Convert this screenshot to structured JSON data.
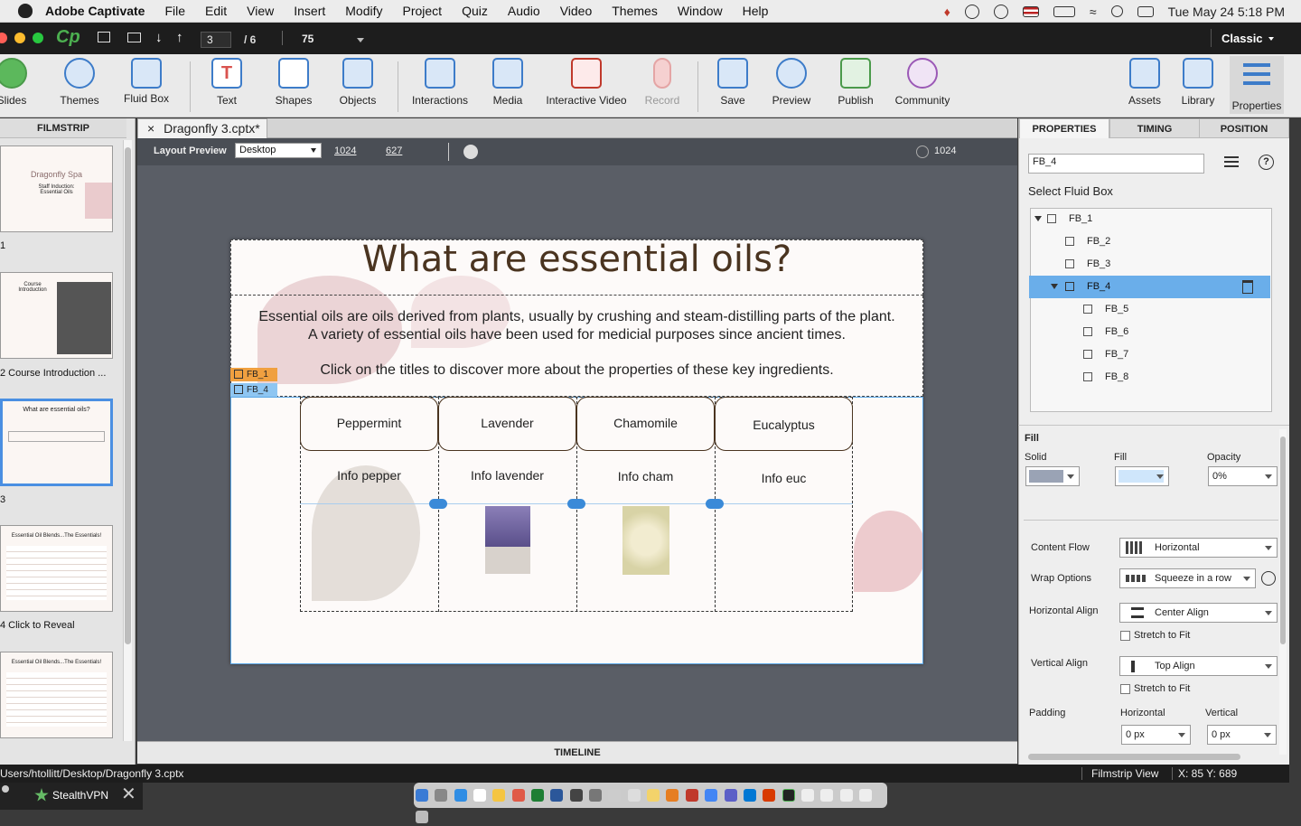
{
  "menubar": {
    "app_name": "Adobe Captivate",
    "items": [
      "File",
      "Edit",
      "View",
      "Insert",
      "Modify",
      "Project",
      "Quiz",
      "Audio",
      "Video",
      "Themes",
      "Window",
      "Help"
    ],
    "datetime": "Tue May 24  5:18 PM"
  },
  "topbar": {
    "slide_current": "3",
    "slide_total": "/ 6",
    "zoom": "75",
    "workspace": "Classic"
  },
  "toolbar": {
    "slides": "Slides",
    "themes": "Themes",
    "fluid_box": "Fluid Box",
    "text": "Text",
    "shapes": "Shapes",
    "objects": "Objects",
    "interactions": "Interactions",
    "media": "Media",
    "interactive_video": "Interactive Video",
    "record": "Record",
    "save": "Save",
    "preview": "Preview",
    "publish": "Publish",
    "community": "Community",
    "assets": "Assets",
    "library": "Library",
    "properties": "Properties"
  },
  "filmstrip": {
    "header": "FILMSTRIP",
    "slides": [
      {
        "label": "1",
        "title": "Dragonfly Spa",
        "subtitle": "Staff Induction:",
        "subtitle2": "Essential Oils"
      },
      {
        "label": "2 Course Introduction ...",
        "title": "Course Introduction"
      },
      {
        "label": "3",
        "title": "What are essential oils?"
      },
      {
        "label": "4 Click to Reveal",
        "title": "Essential Oil Blends...The Essentials!"
      },
      {
        "label": "",
        "title": "Essential Oil Blends...The Essentials!"
      }
    ]
  },
  "document": {
    "tab_title": "Dragonfly 3.cptx*",
    "close": "×"
  },
  "stagebar": {
    "layout_label": "Layout Preview",
    "device": "Desktop",
    "width": "1024",
    "height": "627",
    "ruler_value": "1024"
  },
  "slide": {
    "title": "What are essential oils?",
    "body_line1": "Essential oils are oils derived from plants, usually by crushing and steam-distilling parts of the plant.",
    "body_line2": "A variety of essential oils have been used for medicial purposes since ancient times.",
    "instruction": "Click on the titles to discover more about the properties of these key ingredients.",
    "tag_fb1": "FB_1",
    "tag_fb4": "FB_4",
    "columns": [
      {
        "title": "Peppermint",
        "info": "Info pepper"
      },
      {
        "title": "Lavender",
        "info": "Info lavender"
      },
      {
        "title": "Chamomile",
        "info": "Info cham"
      },
      {
        "title": "Eucalyptus",
        "info": "Info euc"
      }
    ]
  },
  "timeline": {
    "label": "TIMELINE"
  },
  "properties": {
    "tabs": [
      "PROPERTIES",
      "TIMING",
      "POSITION"
    ],
    "name_value": "FB_4",
    "select_label": "Select Fluid Box",
    "tree": [
      "FB_1",
      "FB_2",
      "FB_3",
      "FB_4",
      "FB_5",
      "FB_6",
      "FB_7",
      "FB_8"
    ],
    "fill_section": "Fill",
    "solid_label": "Solid",
    "fill_label": "Fill",
    "opacity_label": "Opacity",
    "opacity_value": "0%",
    "content_flow_label": "Content Flow",
    "content_flow_value": "Horizontal",
    "wrap_label": "Wrap Options",
    "wrap_value": "Squeeze in a row",
    "halign_label": "Horizontal Align",
    "halign_value": "Center Align",
    "stretch1": "Stretch to Fit",
    "valign_label": "Vertical Align",
    "valign_value": "Top Align",
    "stretch2": "Stretch to Fit",
    "padding_label": "Padding",
    "pad_h_label": "Horizontal",
    "pad_v_label": "Vertical",
    "pad_h_value": "0 px",
    "pad_v_value": "0 px"
  },
  "status": {
    "path": "Users/htollitt/Desktop/Dragonfly 3.cptx",
    "view": "Filmstrip View",
    "coords": "X: 85 Y: 689"
  },
  "vpn": {
    "label": "StealthVPN"
  },
  "colors": {
    "accent": "#3d7cc9",
    "selection": "#6aaeea",
    "fb1_tag": "#f0a040",
    "fb4_tag": "#8ec6f2"
  }
}
